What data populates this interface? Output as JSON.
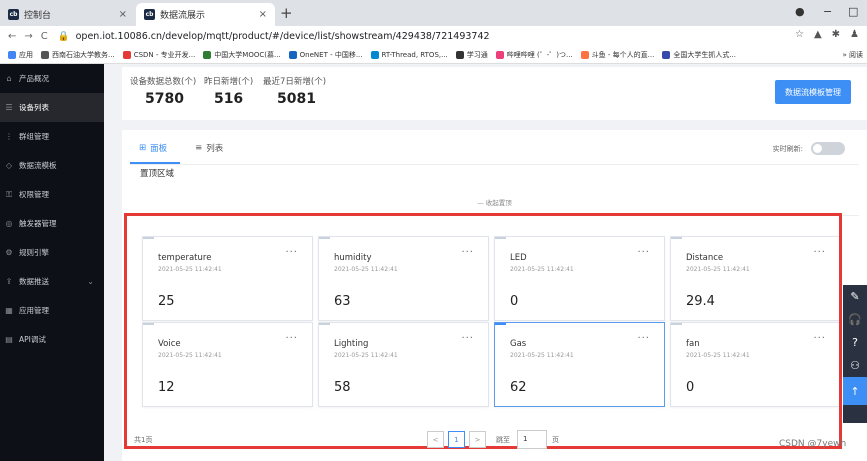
{
  "browser": {
    "tabs": [
      {
        "title": "控制台",
        "favicon": "cb",
        "close": "×"
      },
      {
        "title": "数据流展示",
        "favicon": "cb",
        "close": "×"
      }
    ],
    "newtab": "+",
    "window_controls": {
      "minimize": "−",
      "maximize": "□"
    },
    "url": "open.iot.10086.cn/develop/mqtt/product/#/device/list/showstream/429438/721493742",
    "bookmarks": [
      {
        "label": "应用",
        "color": "#4285f4"
      },
      {
        "label": "西南石油大学教务...",
        "color": "#555"
      },
      {
        "label": "CSDN - 专业开发...",
        "color": "#e53935"
      },
      {
        "label": "中国大学MOOC(慕...",
        "color": "#2e7d32"
      },
      {
        "label": "OneNET - 中国移...",
        "color": "#1565c0"
      },
      {
        "label": "RT-Thread, RTOS,...",
        "color": "#0288d1"
      },
      {
        "label": "学习通",
        "color": "#333"
      },
      {
        "label": "哔哩哔哩 (゜-゜)つ...",
        "color": "#ec407a"
      },
      {
        "label": "斗鱼 - 每个人的直...",
        "color": "#ff7043"
      },
      {
        "label": "全国大学生抓人式...",
        "color": "#3949ab"
      }
    ],
    "bookmarks_more": "» 阅读"
  },
  "sidebar": {
    "items": [
      {
        "label": "产品概况",
        "icon": "⌂"
      },
      {
        "label": "设备列表",
        "icon": "☰",
        "active": true
      },
      {
        "label": "群组管理",
        "icon": "⋮"
      },
      {
        "label": "数据流模板",
        "icon": "◇"
      },
      {
        "label": "权限管理",
        "icon": "⚿"
      },
      {
        "label": "触发器管理",
        "icon": "◎"
      },
      {
        "label": "规则引擎",
        "icon": "⚙"
      },
      {
        "label": "数据推送",
        "icon": "⇪",
        "chevron": "⌄"
      },
      {
        "label": "应用管理",
        "icon": "▦"
      },
      {
        "label": "API调试",
        "icon": "▤"
      }
    ]
  },
  "stats": {
    "total_label": "设备数据总数(个)",
    "total_value": "5780",
    "yesterday_label": "昨日新增(个)",
    "yesterday_value": "516",
    "week_label": "最近7日新增(个)",
    "week_value": "5081",
    "template_button": "数据流模板管理"
  },
  "view": {
    "tab_panel": "面板",
    "tab_list": "列表",
    "auto_refresh": "实时刷新:",
    "pinned_area": "置顶区域",
    "collapse": "— 收起置顶"
  },
  "cards": [
    {
      "name": "temperature",
      "time": "2021-05-25 11:42:41",
      "value": "25"
    },
    {
      "name": "humidity",
      "time": "2021-05-25 11:42:41",
      "value": "63"
    },
    {
      "name": "LED",
      "time": "2021-05-25 11:42:41",
      "value": "0"
    },
    {
      "name": "Distance",
      "time": "2021-05-25 11:42:41",
      "value": "29.4"
    },
    {
      "name": "Voice",
      "time": "2021-05-25 11:42:41",
      "value": "12"
    },
    {
      "name": "Lighting",
      "time": "2021-05-25 11:42:41",
      "value": "58"
    },
    {
      "name": "Gas",
      "time": "2021-05-25 11:42:41",
      "value": "62"
    },
    {
      "name": "fan",
      "time": "2021-05-25 11:42:41",
      "value": "0"
    }
  ],
  "card_more": "···",
  "pager": {
    "total": "共1页",
    "prev": "<",
    "current": "1",
    "next": ">",
    "goto": "跳至",
    "goto_value": "1",
    "page": "页"
  },
  "floatbar": [
    "✎",
    "🎧",
    "?",
    "⚇",
    "↑"
  ],
  "watermark": "CSDN @7yewh"
}
